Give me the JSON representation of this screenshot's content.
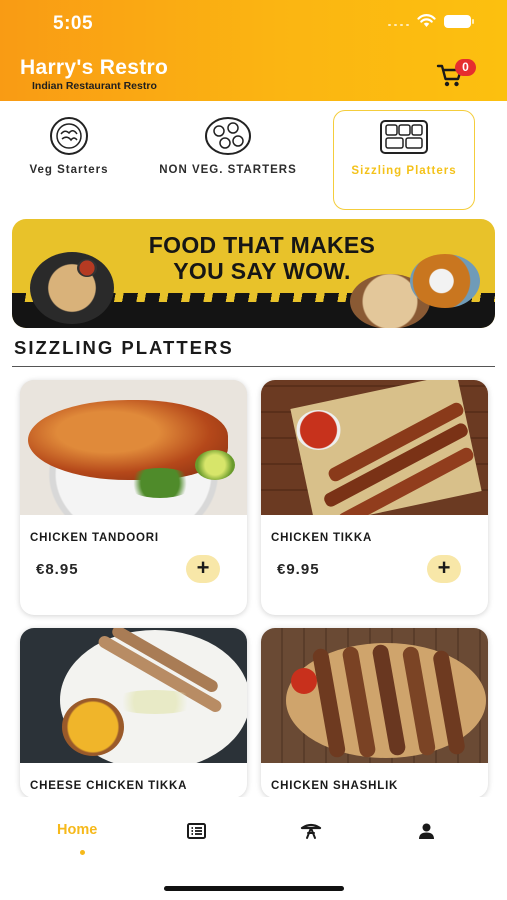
{
  "status_bar": {
    "time": "5:05"
  },
  "header": {
    "title": "Harry's Restro",
    "subtitle": "Indian Restaurant Restro",
    "cart_count": "0",
    "cart_icon": "cart-icon"
  },
  "categories": [
    {
      "label": "Veg Starters",
      "icon": "veg-plate-icon",
      "active": false
    },
    {
      "label": "NON VEG. STARTERS",
      "icon": "nonveg-plate-icon",
      "active": false
    },
    {
      "label": "Sizzling Platters",
      "icon": "sizzling-platter-icon",
      "active": true
    }
  ],
  "banner": {
    "line1": "FOOD THAT MAKES",
    "line2": "YOU SAY WOW."
  },
  "section": {
    "title": "SIZZLING PLATTERS"
  },
  "products": [
    {
      "name": "CHICKEN TANDOORI",
      "price": "€8.95",
      "add": "+"
    },
    {
      "name": "CHICKEN TIKKA",
      "price": "€9.95",
      "add": "+"
    },
    {
      "name": "CHEESE CHICKEN TIKKA",
      "price": "",
      "add": "+"
    },
    {
      "name": "CHICKEN SHASHLIK",
      "price": "",
      "add": "+"
    }
  ],
  "bottom_nav": {
    "home_label": "Home",
    "items": [
      "home",
      "menu-icon",
      "dish-icon",
      "profile-icon"
    ]
  },
  "colors": {
    "accent": "#f6b91b",
    "header_start": "#f99b14",
    "header_end": "#fcc00f",
    "badge": "#e62e2e"
  }
}
